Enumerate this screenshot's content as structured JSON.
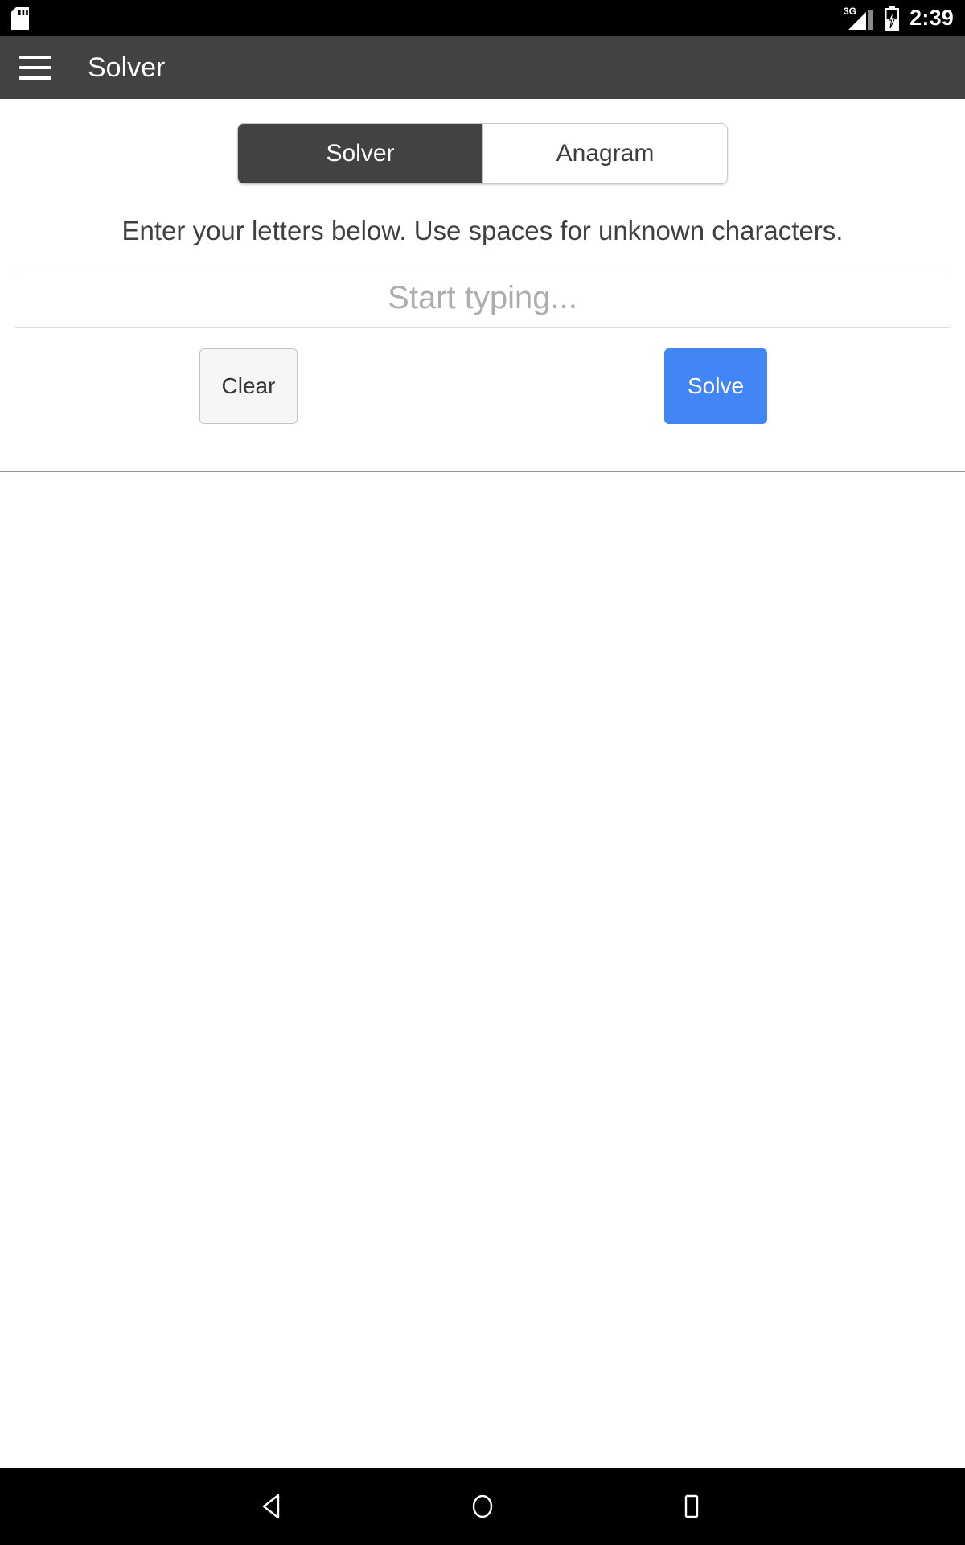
{
  "status_bar": {
    "sd_icon": "sd-card-icon",
    "network_label": "3G",
    "signal_icon": "signal-bars-icon",
    "battery_icon": "battery-charging-icon",
    "time": "2:39"
  },
  "app_bar": {
    "menu_icon": "hamburger-menu-icon",
    "title": "Solver"
  },
  "tabs": {
    "items": [
      {
        "label": "Solver",
        "active": true
      },
      {
        "label": "Anagram",
        "active": false
      }
    ]
  },
  "main": {
    "instructions": "Enter your letters below. Use spaces for unknown characters.",
    "input": {
      "value": "",
      "placeholder": "Start typing..."
    },
    "clear_label": "Clear",
    "solve_label": "Solve"
  },
  "colors": {
    "app_bar": "#424242",
    "active_tab": "#424242",
    "solve_button": "#4285f4",
    "status_bar": "#000000",
    "divider": "#8f8f8f"
  },
  "nav_bar": {
    "back_icon": "back-triangle-icon",
    "home_icon": "home-circle-icon",
    "recents_icon": "recents-square-icon"
  }
}
